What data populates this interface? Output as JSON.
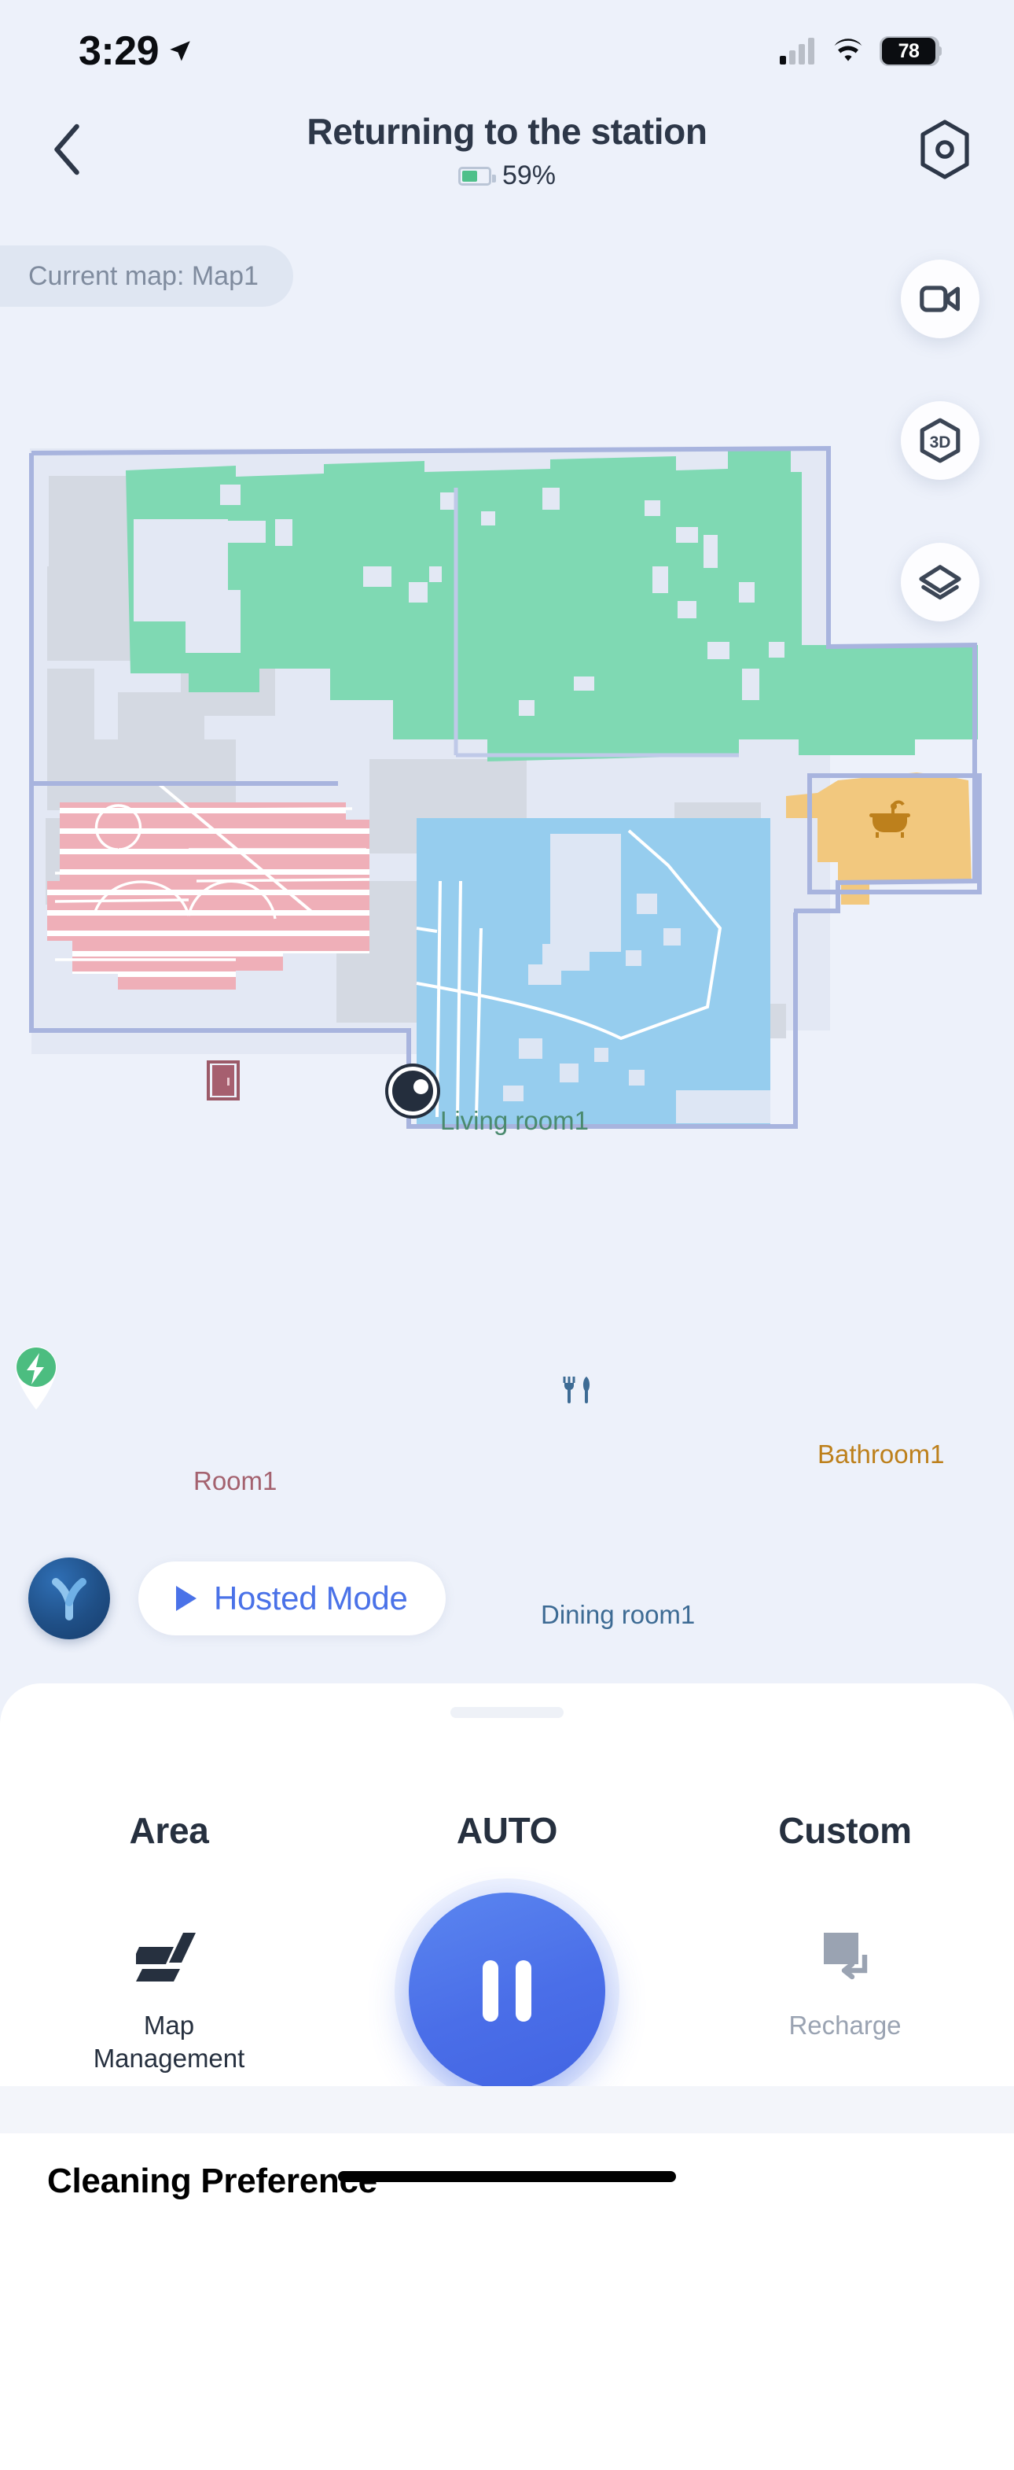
{
  "status_bar": {
    "time": "3:29",
    "location_icon": "location-arrow-icon",
    "cellular_icon": "cellular-bars-icon",
    "wifi_icon": "wifi-icon",
    "battery_level": "78"
  },
  "header": {
    "back_icon": "chevron-left-icon",
    "title": "Returning to the station",
    "battery_percent": "59%",
    "battery_fill_ratio": 0.59,
    "settings_icon": "hex-target-icon"
  },
  "map_chip": {
    "label": "Current map: Map1"
  },
  "floating_buttons": [
    {
      "name": "video-camera-icon",
      "tooltip": "Video"
    },
    {
      "name": "3d-view-icon",
      "label": "3D"
    },
    {
      "name": "layers-icon",
      "tooltip": "Layers"
    }
  ],
  "map": {
    "robot_marker": "robot-position-marker",
    "dock_marker": "charging-dock-marker",
    "rooms": [
      {
        "id": "living",
        "label": "Living room1",
        "color": "#7fd9b3",
        "text_color": "#4a8a6e",
        "icon": "sofa-icon"
      },
      {
        "id": "room1",
        "label": "Room1",
        "color": "#efafb8",
        "text_color": "#a4626f",
        "icon": "door-icon"
      },
      {
        "id": "bathroom",
        "label": "Bathroom1",
        "color": "#f2c87e",
        "text_color": "#bd801c",
        "icon": "bathtub-icon"
      },
      {
        "id": "dining",
        "label": "Dining room1",
        "color": "#96cdee",
        "text_color": "#3d6b94",
        "icon": "cutlery-icon"
      }
    ],
    "wall_color": "#a8b4de",
    "unknown_color": "#d4d9e2",
    "background_color": "#e7ecf7"
  },
  "hosted_mode": {
    "brand_logo": "y-brand-logo",
    "play_icon": "play-triangle-icon",
    "label": "Hosted Mode",
    "accent_color": "#4a72e8"
  },
  "control_sheet": {
    "grabber": "drag-handle",
    "tabs": [
      {
        "id": "area",
        "label": "Area"
      },
      {
        "id": "auto",
        "label": "AUTO"
      },
      {
        "id": "custom",
        "label": "Custom"
      }
    ],
    "left_action": {
      "icon": "map-management-icon",
      "label": "Map\nManagement",
      "label_line1": "Map",
      "label_line2": "Management",
      "enabled": true
    },
    "main_action": {
      "icon": "pause-icon",
      "state": "pause",
      "color": "#4a6ee8"
    },
    "right_action": {
      "icon": "recharge-icon",
      "label": "Recharge",
      "enabled": false
    }
  },
  "bottom_section": {
    "title": "Cleaning Preference"
  }
}
